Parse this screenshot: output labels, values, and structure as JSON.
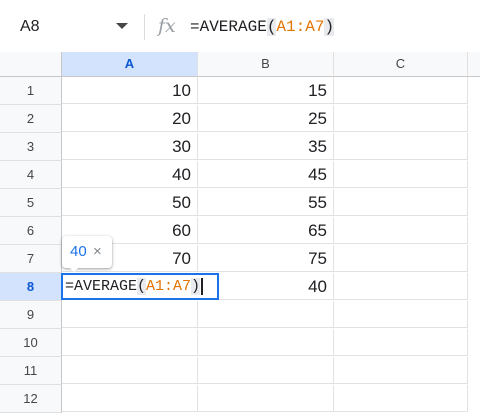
{
  "formula_bar": {
    "name_box": "A8",
    "fx_label": "fx",
    "formula_prefix": "=AVERAGE",
    "formula_open": "(",
    "formula_range": "A1:A7",
    "formula_close": ")"
  },
  "columns": [
    "A",
    "B",
    "C"
  ],
  "rows": [
    "1",
    "2",
    "3",
    "4",
    "5",
    "6",
    "7",
    "8",
    "9",
    "10",
    "11",
    "12"
  ],
  "col_a": [
    "10",
    "20",
    "30",
    "40",
    "50",
    "60",
    "70"
  ],
  "col_b": [
    "15",
    "25",
    "35",
    "45",
    "55",
    "65",
    "75",
    "40"
  ],
  "active_cell": {
    "formula_prefix": "=AVERAGE",
    "formula_open": "(",
    "formula_range": "A1:A7",
    "formula_close": ")"
  },
  "tooltip": {
    "preview_value": "40",
    "close_glyph": "×"
  },
  "colors": {
    "selection": "#d3e3fd",
    "active_border": "#1a73e8",
    "range_ref": "#e37400"
  }
}
